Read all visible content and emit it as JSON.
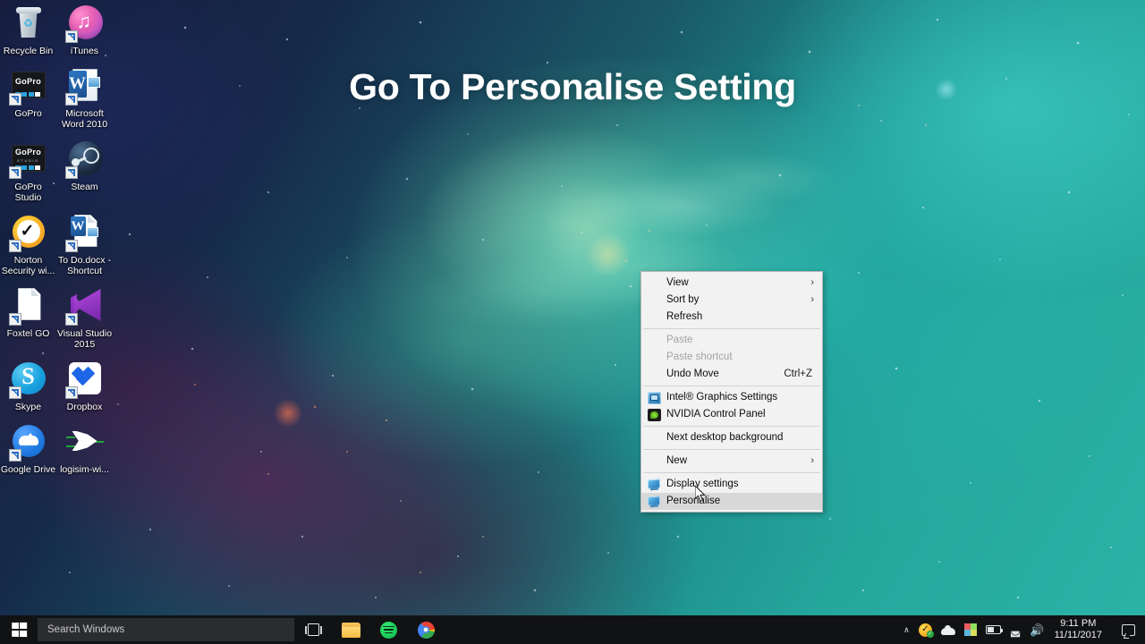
{
  "overlay": {
    "title": "Go To Personalise Setting"
  },
  "desktop": {
    "icons": [
      {
        "label": "Recycle Bin",
        "icon": "recycle-bin-icon",
        "shortcut": false
      },
      {
        "label": "iTunes",
        "icon": "itunes-icon",
        "shortcut": true
      },
      {
        "label": "GoPro",
        "icon": "gopro-icon",
        "shortcut": true
      },
      {
        "label": "Microsoft Word 2010",
        "icon": "microsoft-word-icon",
        "shortcut": true
      },
      {
        "label": "GoPro Studio",
        "icon": "gopro-studio-icon",
        "shortcut": true
      },
      {
        "label": "Steam",
        "icon": "steam-icon",
        "shortcut": true
      },
      {
        "label": "Norton Security wi...",
        "icon": "norton-security-icon",
        "shortcut": true
      },
      {
        "label": "To Do.docx - Shortcut",
        "icon": "word-document-icon",
        "shortcut": true
      },
      {
        "label": "Foxtel GO",
        "icon": "generic-file-icon",
        "shortcut": true
      },
      {
        "label": "Visual Studio 2015",
        "icon": "visual-studio-icon",
        "shortcut": true
      },
      {
        "label": "Skype",
        "icon": "skype-icon",
        "shortcut": true
      },
      {
        "label": "Dropbox",
        "icon": "dropbox-icon",
        "shortcut": true
      },
      {
        "label": "Google Drive",
        "icon": "google-drive-icon",
        "shortcut": true
      },
      {
        "label": "logisim-wi...",
        "icon": "logisim-icon",
        "shortcut": false
      }
    ]
  },
  "context_menu": {
    "items": [
      {
        "label": "View",
        "icon": null,
        "submenu": true,
        "disabled": false,
        "selected": false,
        "accel": null
      },
      {
        "label": "Sort by",
        "icon": null,
        "submenu": true,
        "disabled": false,
        "selected": false,
        "accel": null
      },
      {
        "label": "Refresh",
        "icon": null,
        "submenu": false,
        "disabled": false,
        "selected": false,
        "accel": null
      },
      {
        "separator": true
      },
      {
        "label": "Paste",
        "icon": null,
        "submenu": false,
        "disabled": true,
        "selected": false,
        "accel": null
      },
      {
        "label": "Paste shortcut",
        "icon": null,
        "submenu": false,
        "disabled": true,
        "selected": false,
        "accel": null
      },
      {
        "label": "Undo Move",
        "icon": null,
        "submenu": false,
        "disabled": false,
        "selected": false,
        "accel": "Ctrl+Z"
      },
      {
        "separator": true
      },
      {
        "label": "Intel® Graphics Settings",
        "icon": "intel-graphics-icon",
        "submenu": false,
        "disabled": false,
        "selected": false,
        "accel": null
      },
      {
        "label": "NVIDIA Control Panel",
        "icon": "nvidia-icon",
        "submenu": false,
        "disabled": false,
        "selected": false,
        "accel": null
      },
      {
        "separator": true
      },
      {
        "label": "Next desktop background",
        "icon": null,
        "submenu": false,
        "disabled": false,
        "selected": false,
        "accel": null
      },
      {
        "separator": true
      },
      {
        "label": "New",
        "icon": null,
        "submenu": true,
        "disabled": false,
        "selected": false,
        "accel": null
      },
      {
        "separator": true
      },
      {
        "label": "Display settings",
        "icon": "monitor-icon",
        "submenu": false,
        "disabled": false,
        "selected": false,
        "accel": null
      },
      {
        "label": "Personalise",
        "icon": "monitor-icon",
        "submenu": false,
        "disabled": false,
        "selected": true,
        "accel": null
      }
    ],
    "submenu_glyph": "›"
  },
  "taskbar": {
    "start_label": "Start",
    "search": {
      "placeholder": "Search Windows",
      "value": ""
    },
    "buttons": [
      {
        "name": "task-view-button",
        "label": "Task View"
      },
      {
        "name": "file-explorer-button",
        "label": "File Explorer"
      },
      {
        "name": "spotify-button",
        "label": "Spotify"
      },
      {
        "name": "chrome-button",
        "label": "Google Chrome"
      }
    ],
    "tray": {
      "chevron": "∧",
      "items": [
        {
          "name": "norton-tray-icon",
          "label": "Norton Security"
        },
        {
          "name": "onedrive-tray-icon",
          "label": "OneDrive"
        },
        {
          "name": "color-tray-icon",
          "label": "Display Color"
        },
        {
          "name": "battery-tray-icon",
          "label": "Battery"
        },
        {
          "name": "wifi-tray-icon",
          "label": "Network"
        },
        {
          "name": "volume-tray-icon",
          "label": "Volume"
        }
      ],
      "wifi_glyph": "◛",
      "volume_glyph": "🔊",
      "clock": {
        "time": "9:11 PM",
        "date": "11/11/2017"
      },
      "action_center_label": "Action Center"
    }
  },
  "colors": {
    "menu_bg": "#f2f2f2",
    "menu_selected": "#d8d8d8",
    "taskbar_bg": "#111214",
    "search_bg": "#2b2c2e",
    "accent_teal": "#2bb3a6"
  }
}
